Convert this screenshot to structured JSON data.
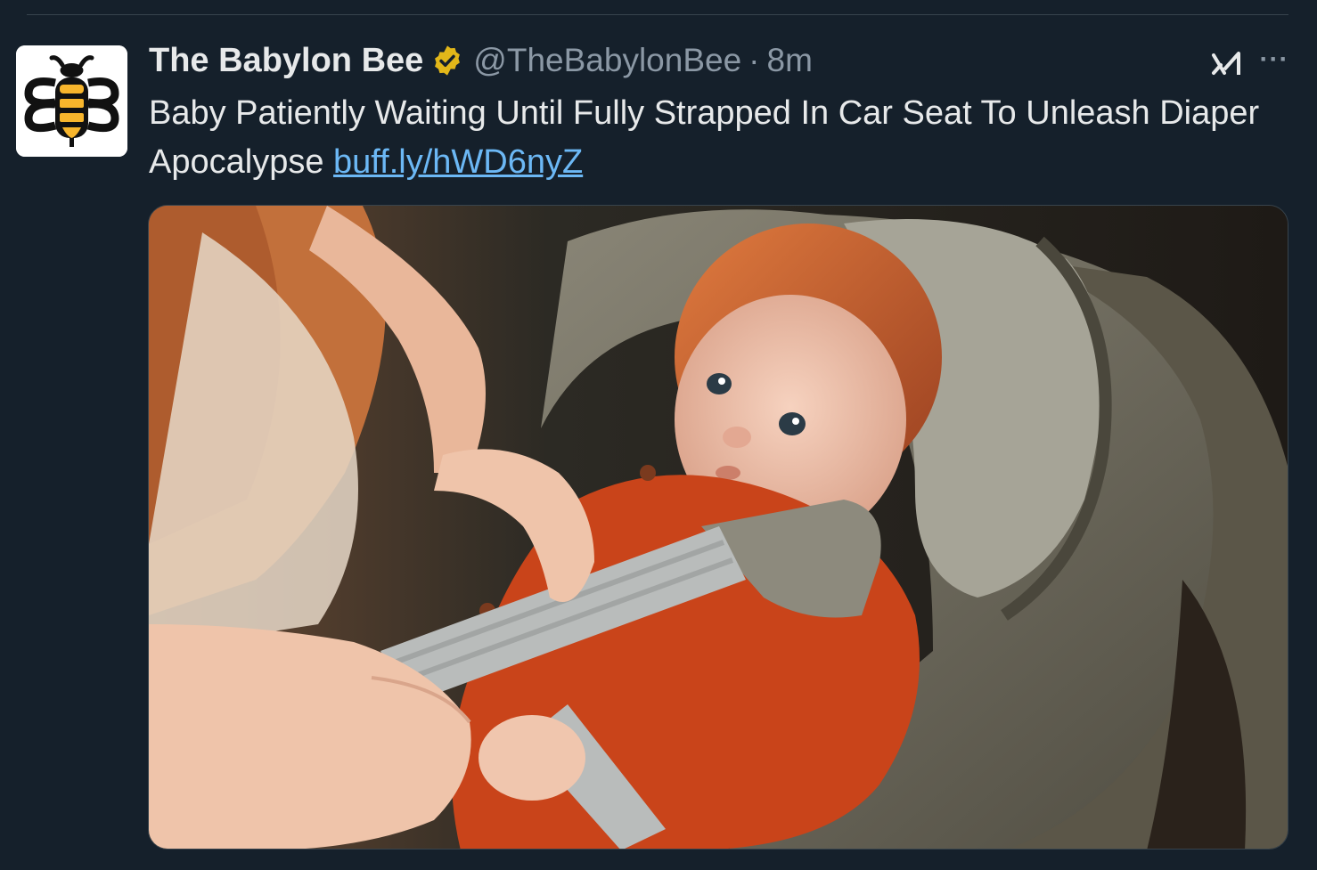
{
  "tweet": {
    "author": {
      "display_name": "The Babylon Bee",
      "handle": "@TheBabylonBee",
      "verified": true,
      "verified_badge_color": "#e2b719"
    },
    "separator": "·",
    "time": "8m",
    "text": "Baby Patiently Waiting Until Fully Strapped In Car Seat To Unleash Diaper Apocalypse ",
    "link": "buff.ly/hWD6nyZ",
    "more_label": "···",
    "grok_icon": "grok-icon",
    "media": {
      "description_icon": "photo-media"
    }
  },
  "colors": {
    "background": "#15202b",
    "text": "#e7e9ea",
    "muted": "#8b98a5",
    "link": "#6cb8f5"
  }
}
